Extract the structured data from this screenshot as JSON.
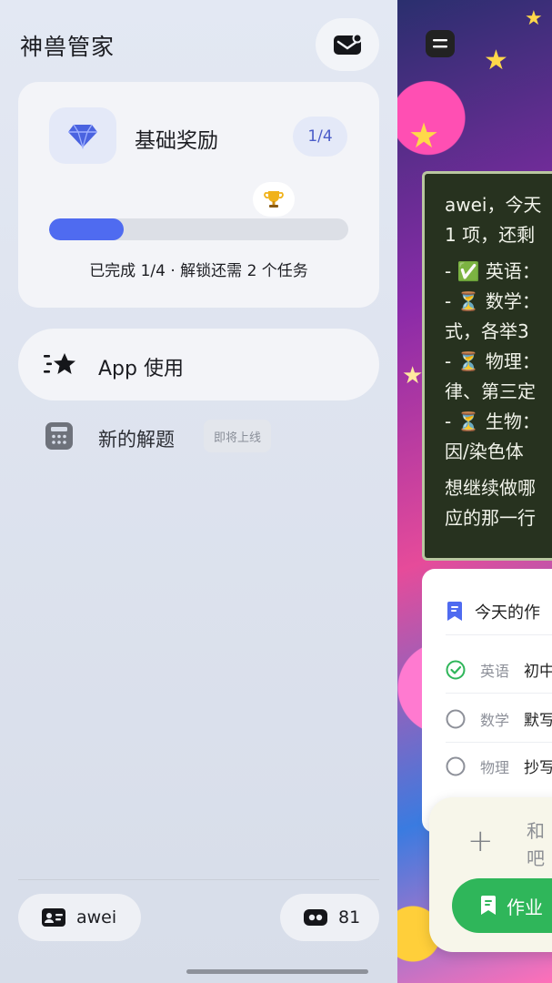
{
  "app": {
    "title": "神兽管家"
  },
  "reward": {
    "title": "基础奖励",
    "badge": "1/4",
    "progress": 0.25,
    "progress_text": "已完成 1/4 · 解锁还需 2 个任务"
  },
  "menu": {
    "app_usage": "App 使用",
    "new_solver": "新的解题",
    "coming_soon": "即将上线"
  },
  "footer": {
    "username": "awei",
    "coins": "81"
  },
  "chat": {
    "lines": [
      "awei，今天",
      "1 项，还剩",
      "- ✅ 英语：",
      "- ⏳ 数学：",
      "式，各举3",
      "- ⏳ 物理：",
      "律、第三定",
      "- ⏳ 生物：",
      "因/染色体",
      "想继续做哪",
      "应的那一行"
    ]
  },
  "homework": {
    "header": "今天的作",
    "rows": [
      {
        "subject": "英语",
        "task": "初中",
        "done": true
      },
      {
        "subject": "数学",
        "task": "默写",
        "done": false
      },
      {
        "subject": "物理",
        "task": "抄写",
        "done": false
      }
    ]
  },
  "composer": {
    "placeholder_line1": "和",
    "placeholder_line2": "吧",
    "button_label": "作业"
  },
  "colors": {
    "accent": "#4f6bf0",
    "success": "#2fb65a",
    "chat_bg": "#27321f"
  },
  "icons": [
    "mail-icon",
    "diamond-icon",
    "trophy-icon",
    "star-list-icon",
    "calculator-icon",
    "id-card-icon",
    "wallet-icon",
    "menu-icon",
    "document-icon",
    "check-circle-icon",
    "empty-circle-icon",
    "plus-icon",
    "homework-icon"
  ]
}
